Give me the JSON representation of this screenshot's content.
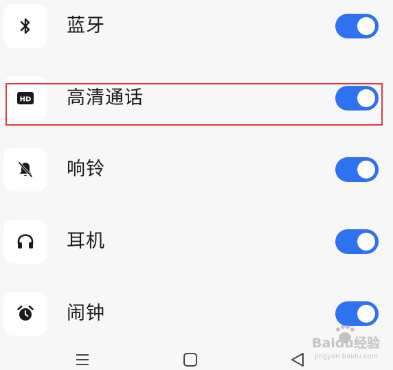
{
  "settings": {
    "items": [
      {
        "label": "蓝牙",
        "icon": "bluetooth-icon",
        "enabled": true
      },
      {
        "label": "高清通话",
        "icon": "hd-icon",
        "enabled": true
      },
      {
        "label": "响铃",
        "icon": "bell-off-icon",
        "enabled": true
      },
      {
        "label": "耳机",
        "icon": "headphones-icon",
        "enabled": true
      },
      {
        "label": "闹钟",
        "icon": "alarm-clock-icon",
        "enabled": true
      }
    ]
  },
  "nav": {
    "buttons": [
      "menu-icon",
      "home-square-icon",
      "back-triangle-icon"
    ]
  },
  "watermark": {
    "text": "Baidu经验",
    "url": "jingyan.baidu.com"
  },
  "colors": {
    "background": "#f7f7f7",
    "toggle_on": "#2f72f0",
    "highlight": "#e03a3a",
    "text": "#1a1a1a"
  }
}
